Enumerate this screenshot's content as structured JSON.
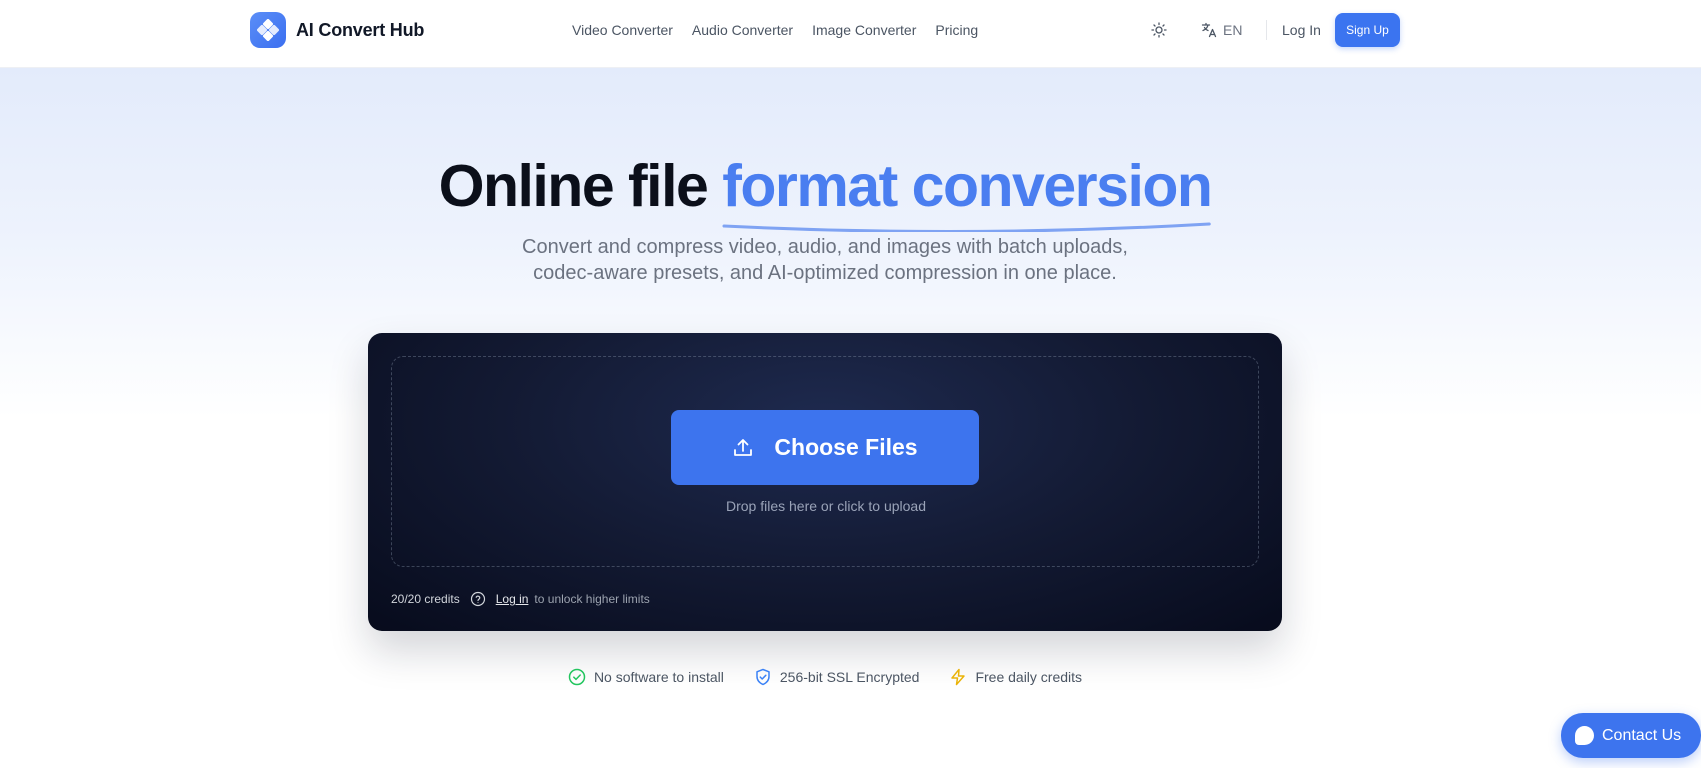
{
  "header": {
    "brand": "AI Convert Hub",
    "nav": [
      "Video Converter",
      "Audio Converter",
      "Image Converter",
      "Pricing"
    ],
    "language": "EN",
    "login": "Log In",
    "signup": "Sign Up"
  },
  "hero": {
    "title_plain": "Online file ",
    "title_accent": "format conversion",
    "subtitle_line1": "Convert and compress video, audio, and images with batch uploads,",
    "subtitle_line2": "codec-aware presets, and AI-optimized compression in one place."
  },
  "upload": {
    "choose_label": "Choose Files",
    "drop_hint": "Drop files here or click to upload",
    "credits": "20/20 credits",
    "login_link": "Log in",
    "login_suffix": "to unlock higher limits"
  },
  "features": [
    {
      "icon": "check-circle-icon",
      "label": "No software to install",
      "color": "#22c55e"
    },
    {
      "icon": "shield-check-icon",
      "label": "256-bit SSL Encrypted",
      "color": "#3b82f6"
    },
    {
      "icon": "lightning-icon",
      "label": "Free daily credits",
      "color": "#eab308"
    }
  ],
  "contact": {
    "label": "Contact Us"
  },
  "colors": {
    "accent": "#4a7ef0",
    "primary_button": "#3d74ee",
    "panel_dark": "#070b1c"
  }
}
